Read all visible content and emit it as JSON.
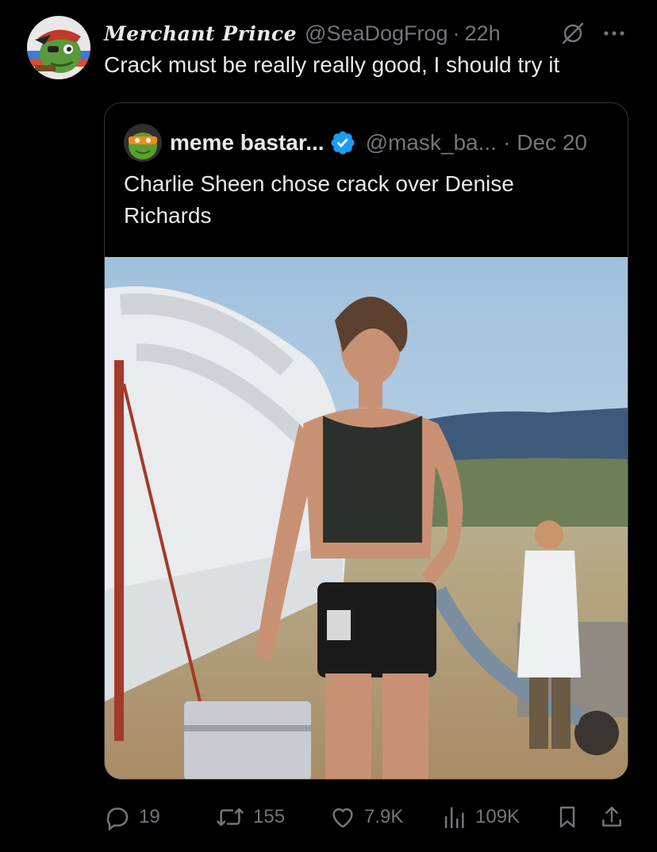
{
  "tweet": {
    "display_name": "Merchant Prince",
    "handle": "@SeaDogFrog",
    "dot": "·",
    "time": "22h",
    "text": "Crack must be really really good, I should try it",
    "avatar_icon": "pirate-frog-avatar",
    "more_icon": "more-dots-icon",
    "grok_icon": "grok-icon"
  },
  "quote": {
    "display_name": "meme bastar...",
    "verified_icon": "verified-badge-icon",
    "handle": "@mask_ba...",
    "dot": "·",
    "date": "Dec 20",
    "text": "Charlie Sheen chose crack over Denise Richards",
    "avatar_icon": "ninja-turtle-avatar",
    "image_alt": "photo"
  },
  "actions": {
    "replies": "19",
    "reposts": "155",
    "likes": "7.9K",
    "views": "109K"
  },
  "colors": {
    "background": "#000000",
    "text": "#e7e9ea",
    "muted": "#71767b",
    "border": "#333639",
    "verified": "#1d9bf0"
  }
}
